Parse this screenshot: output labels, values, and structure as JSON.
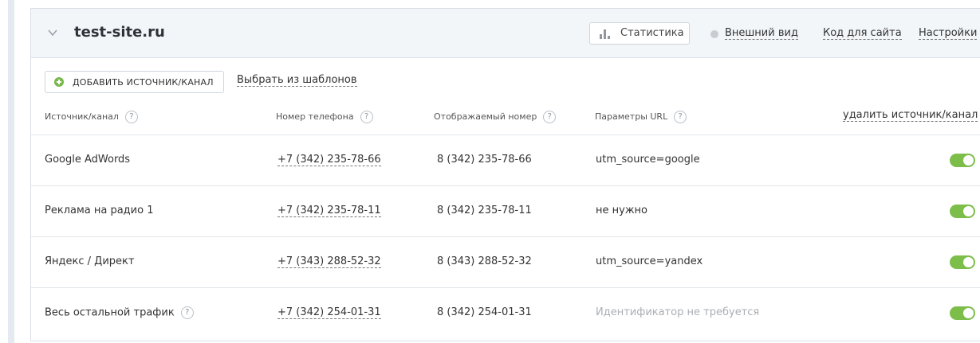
{
  "site": {
    "title": "test-site.ru",
    "stats_label": "Статистика",
    "appearance_label": "Внешний вид",
    "code_label": "Код для сайта",
    "settings_label": "Настройки"
  },
  "toolbar": {
    "add_label": "ДОБАВИТЬ ИСТОЧНИК/КАНАЛ",
    "templates_label": "Выбрать из шаблонов"
  },
  "columns": {
    "source": "Источник/канал",
    "phone": "Номер телефона",
    "display": "Отображаемый номер",
    "url": "Параметры URL",
    "delete": "удалить источник/канал",
    "help": "?"
  },
  "rows": [
    {
      "source": "Google AdWords",
      "phone": "+7 (342) 235-78-66",
      "display": "8 (342) 235-78-66",
      "url": "utm_source=google",
      "enabled": true
    },
    {
      "source": "Реклама на радио 1",
      "phone": "+7 (342) 235-78-11",
      "display": "8 (342) 235-78-11",
      "url": "не нужно",
      "enabled": true
    },
    {
      "source": "Яндекс / Директ",
      "phone": "+7 (343) 288-52-32",
      "display": "8 (343) 288-52-32",
      "url": "utm_source=yandex",
      "enabled": true
    },
    {
      "source": "Весь остальной трафик",
      "phone": "+7 (342) 254-01-31",
      "display": "8 (342) 254-01-31",
      "url": "Идентификатор не требуется",
      "enabled": true
    }
  ],
  "colors": {
    "accent_green": "#7dbd4a",
    "header_bg": "#f3f6f9"
  }
}
